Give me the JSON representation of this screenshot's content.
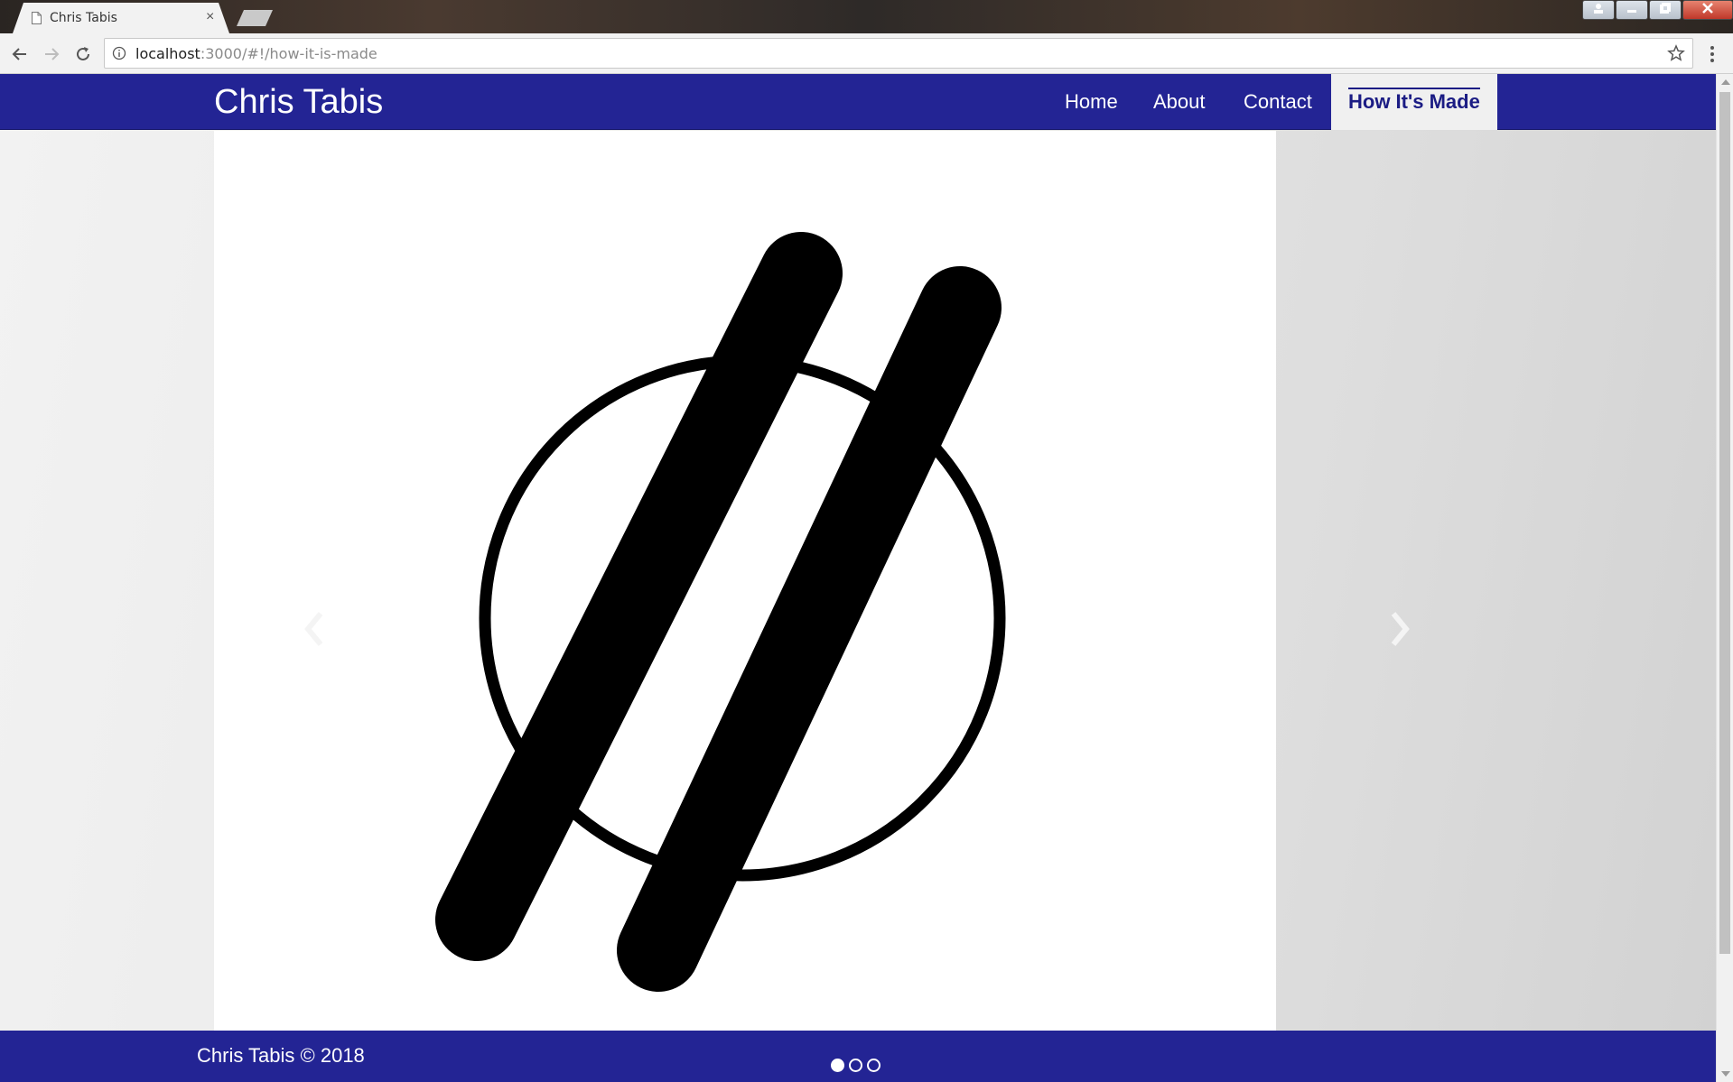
{
  "browser": {
    "tab_title": "Chris Tabis",
    "tab_close": "×",
    "url_host": "localhost",
    "url_rest": ":3000/#!/how-it-is-made"
  },
  "site": {
    "brand": "Chris Tabis",
    "nav": [
      "Home",
      "About",
      "Contact",
      "How It's Made"
    ],
    "active_nav": "How It's Made"
  },
  "carousel": {
    "slide_count": 3,
    "active_slide": 1
  },
  "footer": {
    "text": "Chris Tabis © 2018"
  },
  "colors": {
    "brand_blue": "#232494",
    "active_text": "#1b1c84"
  }
}
